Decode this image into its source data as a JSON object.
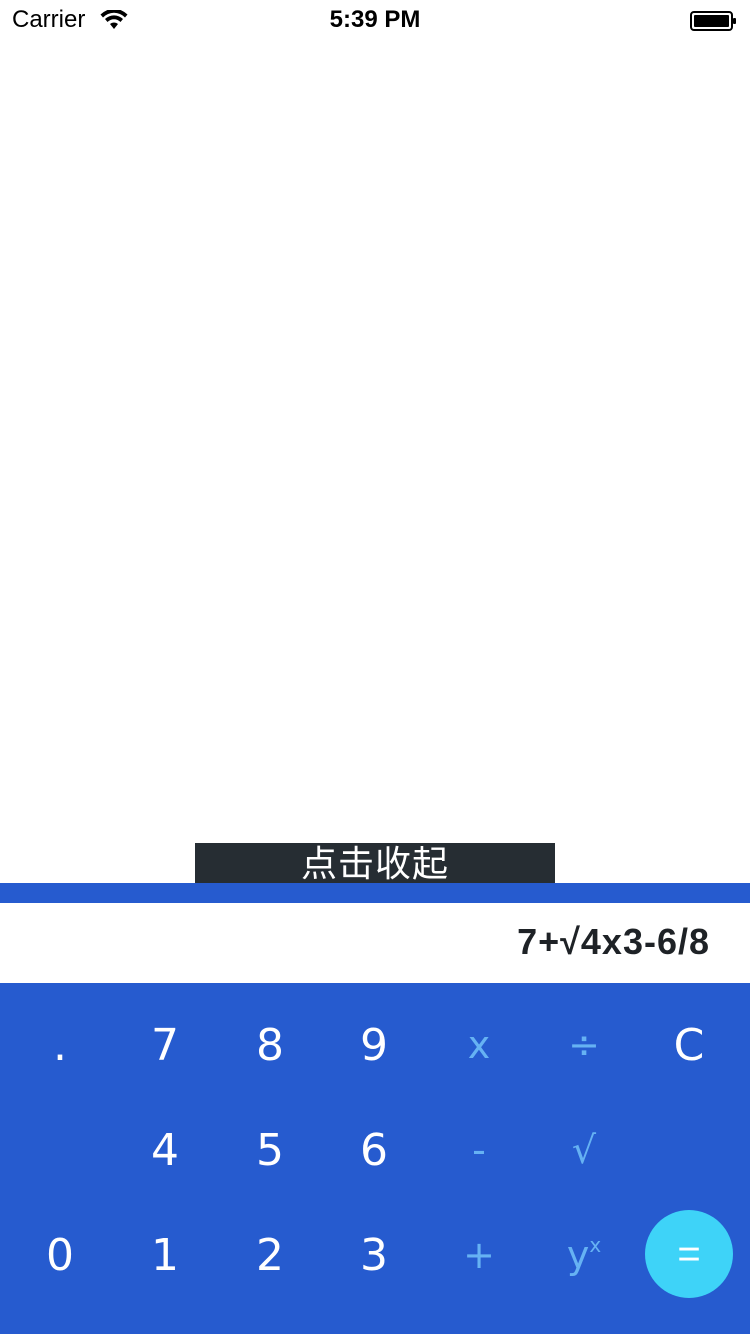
{
  "status_bar": {
    "carrier": "Carrier",
    "time": "5:39 PM"
  },
  "collapse_button": "点击收起",
  "display": {
    "expression": "7+√4x3-6/8"
  },
  "keypad": {
    "row1": [
      ".",
      "7",
      "8",
      "9",
      "x",
      "÷",
      "C"
    ],
    "row2": [
      "4",
      "5",
      "6",
      "-",
      "√"
    ],
    "row3": [
      "0",
      "1",
      "2",
      "3",
      "+",
      "y",
      "x",
      "="
    ]
  },
  "colors": {
    "keyboard_bg": "#265bcf",
    "operator": "#66b2f3",
    "equals_bg": "#3ed3f8",
    "collapse_bg": "#262d33"
  }
}
